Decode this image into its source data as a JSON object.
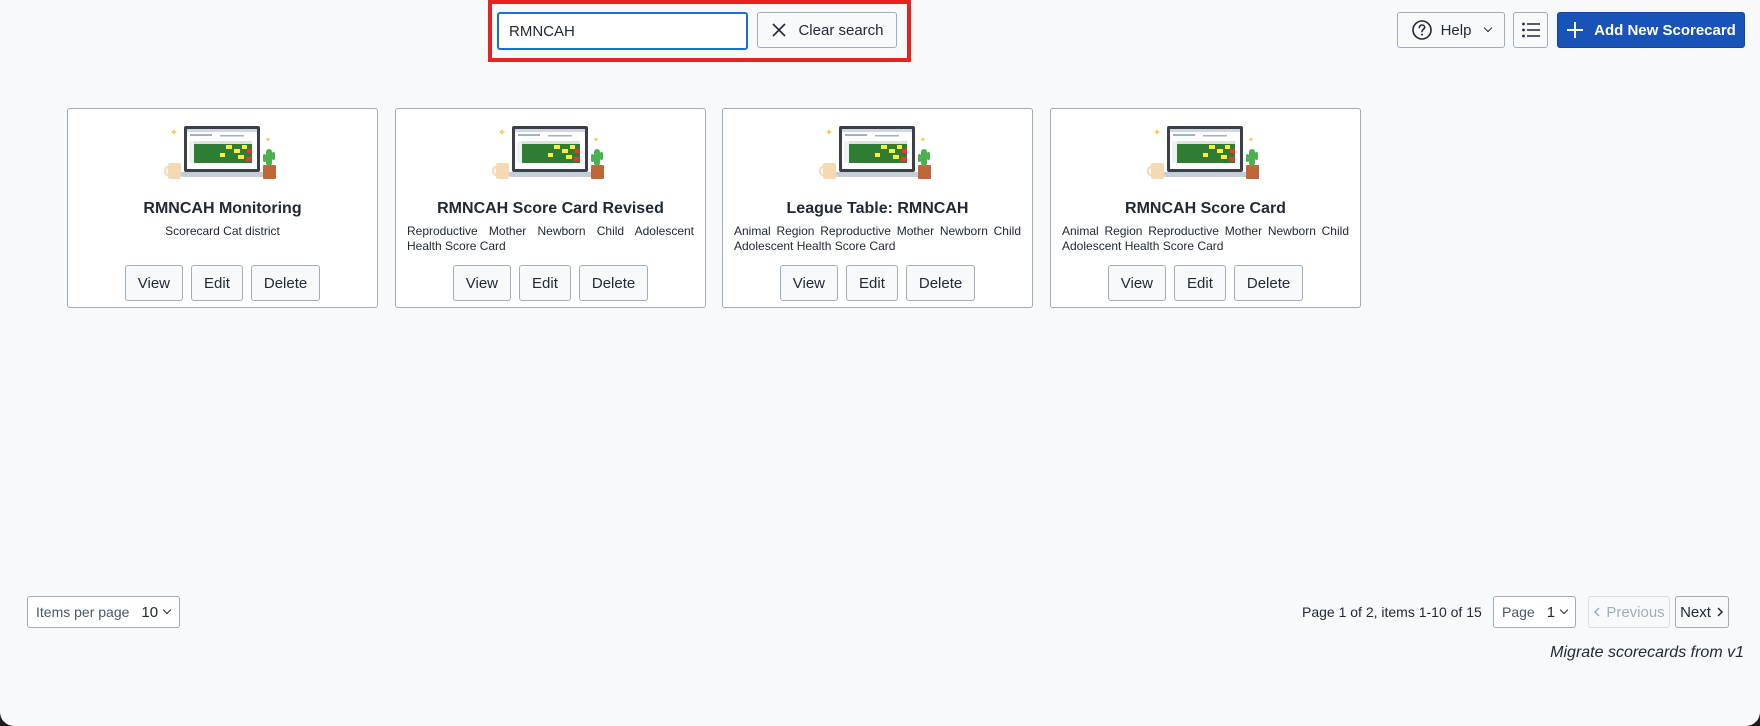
{
  "search": {
    "value": "RMNCAH",
    "clear_label": "Clear search"
  },
  "header": {
    "help_label": "Help",
    "add_label": "Add New Scorecard"
  },
  "cards": [
    {
      "title": "RMNCAH Monitoring",
      "description": "Scorecard Cat district"
    },
    {
      "title": "RMNCAH Score Card Revised",
      "description": "Reproductive Mother Newborn Child Adolescent Health Score Card"
    },
    {
      "title": "League Table: RMNCAH",
      "description": "Animal Region Reproductive Mother Newborn Child Adolescent Health Score Card"
    },
    {
      "title": "RMNCAH Score Card",
      "description": "Animal Region Reproductive Mother Newborn Child Adolescent Health Score Card"
    }
  ],
  "card_actions": {
    "view": "View",
    "edit": "Edit",
    "delete": "Delete"
  },
  "pagination": {
    "items_per_page_label": "Items per page",
    "items_per_page_value": "10",
    "summary": "Page 1 of 2, items 1-10 of 15",
    "page_label": "Page",
    "page_value": "1",
    "previous_label": "Previous",
    "next_label": "Next"
  },
  "footer": {
    "migrate_label": "Migrate scorecards from v1"
  },
  "colors": {
    "primary": "#1853b8",
    "highlight": "#e5231f",
    "focus": "#1a6ed8"
  },
  "icons": {
    "clear": "close-icon",
    "help": "help-circle-icon",
    "list": "list-icon",
    "add": "plus-icon"
  }
}
